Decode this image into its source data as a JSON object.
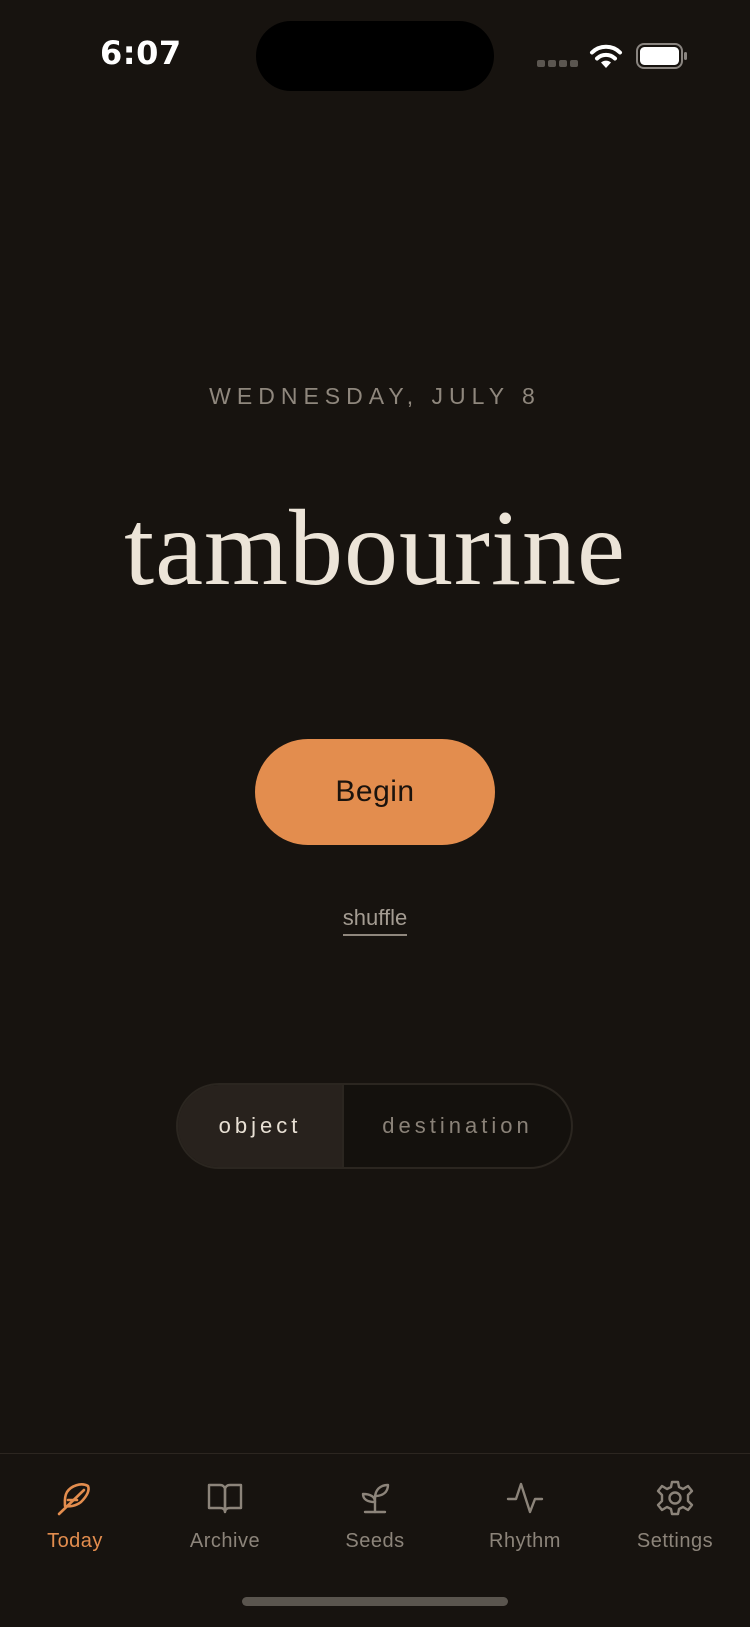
{
  "status_bar": {
    "time": "6:07"
  },
  "today": {
    "date": "WEDNESDAY, JULY 8",
    "word": "tambourine",
    "begin_label": "Begin",
    "shuffle_label": "shuffle"
  },
  "mode_toggle": {
    "options": [
      "object",
      "destination"
    ],
    "selected": "object"
  },
  "tabbar": {
    "items": [
      {
        "label": "Today",
        "icon": "feather-icon",
        "active": true
      },
      {
        "label": "Archive",
        "icon": "book-icon",
        "active": false
      },
      {
        "label": "Seeds",
        "icon": "sprout-icon",
        "active": false
      },
      {
        "label": "Rhythm",
        "icon": "activity-icon",
        "active": false
      },
      {
        "label": "Settings",
        "icon": "gear-icon",
        "active": false
      }
    ]
  },
  "colors": {
    "background": "#17130f",
    "accent": "#e38d4e",
    "text_primary": "#ece4d8",
    "text_muted": "#8c847a"
  }
}
